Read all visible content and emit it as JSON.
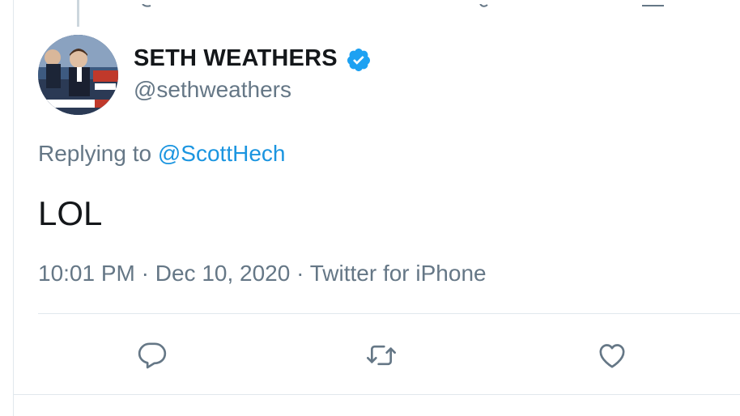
{
  "tweet": {
    "author": {
      "display_name": "SETH WEATHERS",
      "handle": "@sethweathers",
      "verified": true,
      "avatar_icon": "profile-photo"
    },
    "reply_prefix": "Replying to ",
    "reply_to": "@ScottHech",
    "text": "LOL",
    "time": "10:01 PM",
    "date": "Dec 10, 2020",
    "source": "Twitter for iPhone",
    "separator": " · "
  },
  "actions": [
    {
      "name": "reply",
      "icon": "reply-icon"
    },
    {
      "name": "retweet",
      "icon": "retweet-icon"
    },
    {
      "name": "like",
      "icon": "heart-icon"
    }
  ],
  "colors": {
    "accent": "#1b95e0",
    "secondary_text": "#657786",
    "primary_text": "#14171a",
    "verified_badge": "#1da1f2",
    "divider": "#e1e8ed"
  }
}
